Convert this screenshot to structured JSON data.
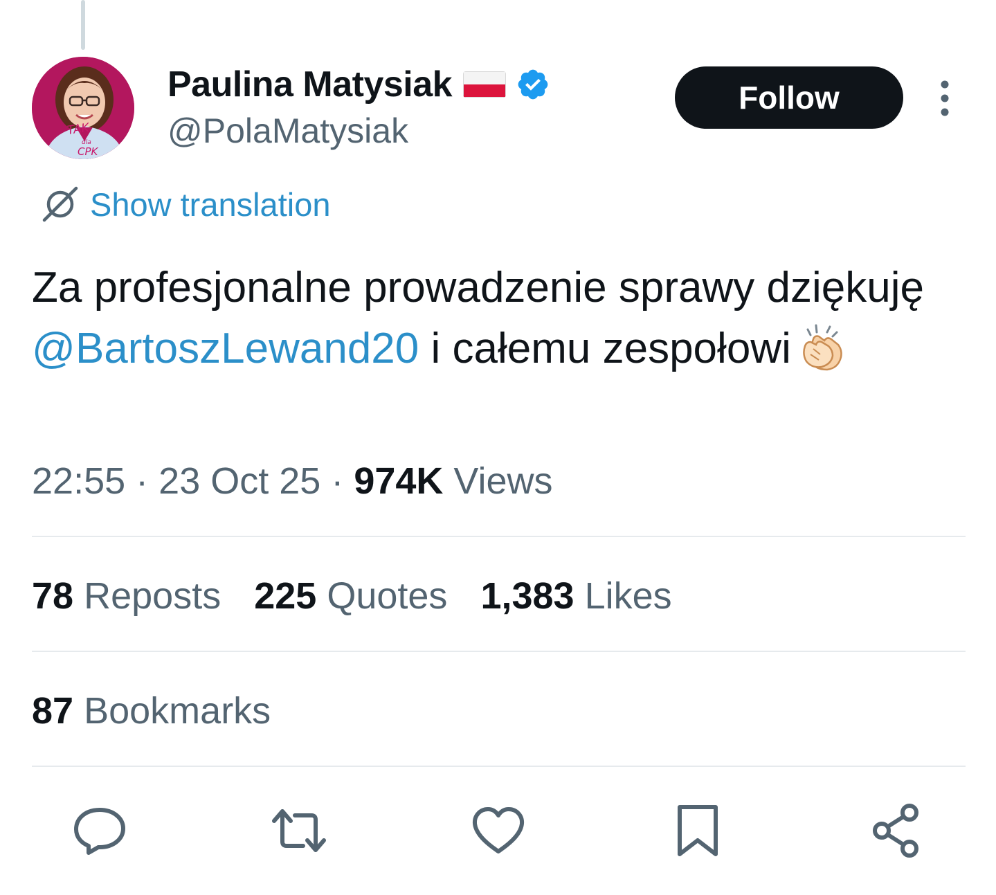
{
  "author": {
    "display_name": "Paulina Matysiak",
    "handle": "@PolaMatysiak",
    "flag_icon": "poland-flag-icon",
    "verified_icon": "verified-badge-icon",
    "avatar_text_top": "TAK",
    "avatar_text_mid": "dla",
    "avatar_text_bottom": "CPK"
  },
  "follow_button": {
    "label": "Follow"
  },
  "translation": {
    "label": "Show translation",
    "icon": "translate-icon"
  },
  "tweet": {
    "text_before_mention": "Za profesjonalne prowadzenie sprawy dziękuję ",
    "mention": "@BartoszLewand20",
    "text_after_mention": " i całemu zespołowi",
    "emoji_icon": "clapping-hands-icon"
  },
  "meta": {
    "time": "22:55",
    "separator": "·",
    "date": "23 Oct 25",
    "views_count": "974K",
    "views_label": "Views"
  },
  "stats": {
    "reposts_count": "78",
    "reposts_label": "Reposts",
    "quotes_count": "225",
    "quotes_label": "Quotes",
    "likes_count": "1,383",
    "likes_label": "Likes",
    "bookmarks_count": "87",
    "bookmarks_label": "Bookmarks"
  },
  "actions": [
    "reply-icon",
    "repost-icon",
    "like-icon",
    "bookmark-icon",
    "share-icon"
  ],
  "colors": {
    "text_primary": "#0f1419",
    "text_secondary": "#536471",
    "link": "#2b8fc9",
    "verified": "#1d9bf0",
    "button_bg": "#0f1419",
    "divider": "#e6eaed"
  }
}
